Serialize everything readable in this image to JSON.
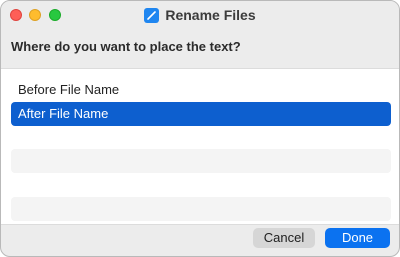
{
  "window": {
    "title": "Rename Files",
    "icon": "pencil-app-icon"
  },
  "prompt": "Where do you want to place the text?",
  "options": [
    {
      "label": "Before File Name",
      "selected": false
    },
    {
      "label": "After File Name",
      "selected": true
    }
  ],
  "buttons": {
    "cancel": "Cancel",
    "done": "Done"
  },
  "colors": {
    "selection": "#0d5fcf",
    "primary_button": "#0b72f0",
    "close": "#fe5f57",
    "minimize": "#febc2e",
    "zoom": "#28c840"
  }
}
